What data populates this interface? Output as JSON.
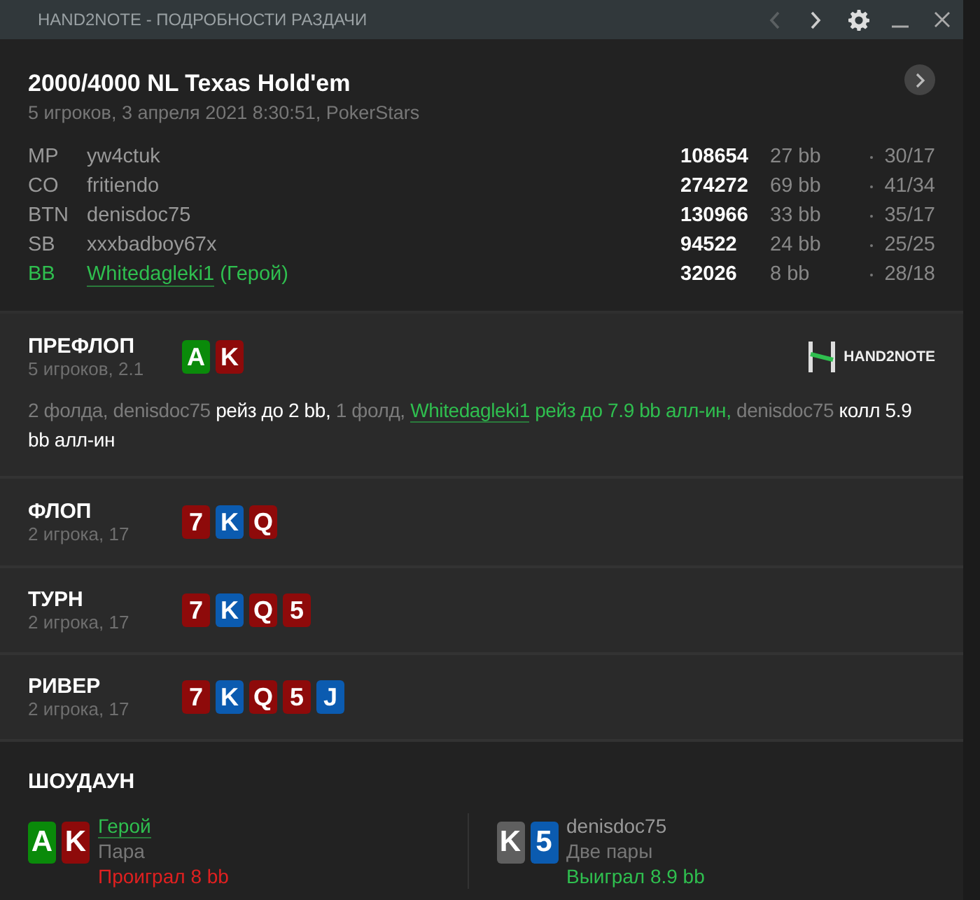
{
  "window": {
    "title": "HAND2NOTE - ПОДРОБНОСТИ РАЗДАЧИ",
    "back_disabled": true
  },
  "hand": {
    "title": "2000/4000 NL Texas Hold'em",
    "subtitle": "5 игроков, 3 апреля 2021 8:30:51, PokerStars",
    "players": [
      {
        "position": "MP",
        "name": "yw4ctuk",
        "hero": false,
        "stack": "108654",
        "bb": "27 bb",
        "stats": "30/17"
      },
      {
        "position": "CO",
        "name": "fritiendo",
        "hero": false,
        "stack": "274272",
        "bb": "69 bb",
        "stats": "41/34"
      },
      {
        "position": "BTN",
        "name": "denisdoc75",
        "hero": false,
        "stack": "130966",
        "bb": "33 bb",
        "stats": "35/17"
      },
      {
        "position": "SB",
        "name": "xxxbadboy67x",
        "hero": false,
        "stack": "94522",
        "bb": "24 bb",
        "stats": "25/25"
      },
      {
        "position": "BB",
        "name": "Whitedagleki1",
        "hero": true,
        "hero_label": "(Герой)",
        "stack": "32026",
        "bb": "8 bb",
        "stats": "28/18"
      }
    ]
  },
  "streets": [
    {
      "name": "ПРЕФЛОП",
      "sub": "5 игроков, 2.1",
      "logo": "HAND2NOTE",
      "cards": [
        {
          "rank": "A",
          "color": "#0a8a0a"
        },
        {
          "rank": "K",
          "color": "#8e0a0a"
        }
      ],
      "actions": [
        {
          "kind": "muted",
          "text": "2 фолда, denisdoc75"
        },
        {
          "kind": "action",
          "text": " рейз до 2 bb,"
        },
        {
          "kind": "muted",
          "text": " 1 фолд, "
        },
        {
          "kind": "hero_link",
          "text": "Whitedagleki1"
        },
        {
          "kind": "hero",
          "text": " рейз до 7.9 bb алл-ин,"
        },
        {
          "kind": "muted",
          "text": " denisdoc75"
        },
        {
          "kind": "action",
          "text": " колл 5.9 bb алл-ин"
        }
      ]
    },
    {
      "name": "ФЛОП",
      "sub": "2 игрока, 17",
      "cards": [
        {
          "rank": "7",
          "color": "#8e0a0a"
        },
        {
          "rank": "K",
          "color": "#0b5bb0"
        },
        {
          "rank": "Q",
          "color": "#8e0a0a"
        }
      ]
    },
    {
      "name": "ТУРН",
      "sub": "2 игрока, 17",
      "cards": [
        {
          "rank": "7",
          "color": "#8e0a0a"
        },
        {
          "rank": "K",
          "color": "#0b5bb0"
        },
        {
          "rank": "Q",
          "color": "#8e0a0a"
        },
        {
          "rank": "5",
          "color": "#8e0a0a"
        }
      ]
    },
    {
      "name": "РИВЕР",
      "sub": "2 игрока, 17",
      "cards": [
        {
          "rank": "7",
          "color": "#8e0a0a"
        },
        {
          "rank": "K",
          "color": "#0b5bb0"
        },
        {
          "rank": "Q",
          "color": "#8e0a0a"
        },
        {
          "rank": "5",
          "color": "#8e0a0a"
        },
        {
          "rank": "J",
          "color": "#0b5bb0"
        }
      ]
    }
  ],
  "showdown": {
    "title": "ШОУДАУН",
    "hands": [
      {
        "player": "Герой",
        "hero": true,
        "combo": "Пара",
        "result": "Проиграл 8 bb",
        "won": false,
        "cards": [
          {
            "rank": "A",
            "color": "#0a8a0a"
          },
          {
            "rank": "K",
            "color": "#8e0a0a"
          }
        ]
      },
      {
        "player": "denisdoc75",
        "hero": false,
        "combo": "Две пары",
        "result": "Выиграл 8.9 bb",
        "won": true,
        "cards": [
          {
            "rank": "K",
            "color": "#5f5f5f"
          },
          {
            "rank": "5",
            "color": "#0b5bb0"
          }
        ]
      }
    ]
  }
}
